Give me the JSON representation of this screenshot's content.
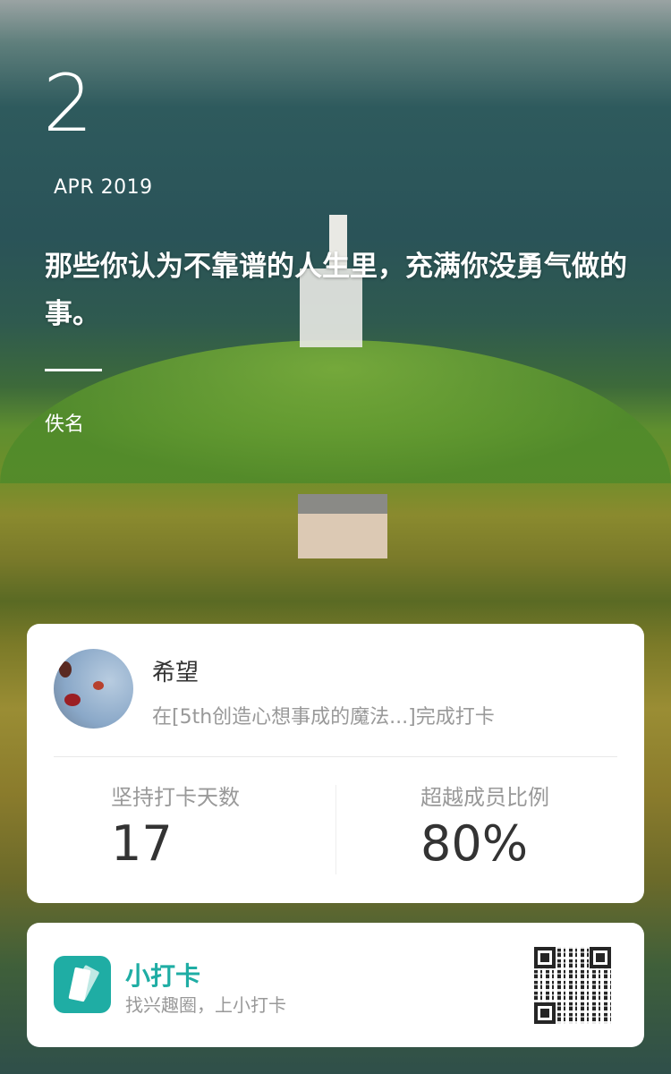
{
  "date": {
    "day": "2",
    "month_year": "APR 2019"
  },
  "quote": {
    "text": "那些你认为不靠谱的人生里，充满你没勇气做的事。",
    "author": "佚名"
  },
  "checkin_card": {
    "user_name": "希望",
    "description": "在[5th创造心想事成的魔法...]完成打卡",
    "stats": [
      {
        "label": "坚持打卡天数",
        "value": "17"
      },
      {
        "label": "超越成员比例",
        "value": "80%"
      }
    ]
  },
  "brand_card": {
    "name": "小打卡",
    "slogan": "找兴趣圈，上小打卡",
    "accent_color": "#1fada4",
    "qr_icon": "qr-code"
  }
}
